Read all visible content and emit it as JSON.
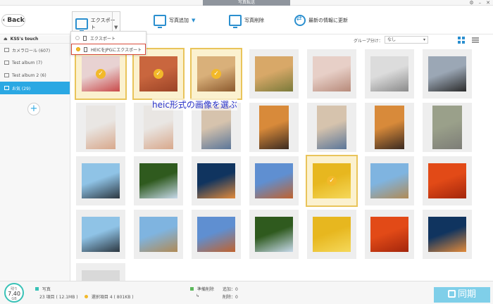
{
  "window": {
    "title": "写真転送"
  },
  "toolbar": {
    "back_label": "Back",
    "export_label": "エクスポート",
    "add_label": "写真追加",
    "delete_label": "写真削除",
    "refresh_label": "最新の情報に更新"
  },
  "export_menu": {
    "items": [
      {
        "label": "エクスポート"
      },
      {
        "label": "HEICをJPGにエクスポート"
      }
    ]
  },
  "subbar": {
    "group_label": "グループ分け：",
    "group_value": "なし"
  },
  "sidebar": {
    "device": "KSS's touch",
    "items": [
      {
        "label": "カメラロール (607)"
      },
      {
        "label": "Test album (7)"
      },
      {
        "label": "Test album 2 (6)"
      },
      {
        "label": "お気 (29)"
      }
    ]
  },
  "gallery": {
    "annotation": "heic形式の画像を選ぶ",
    "photos": [
      {
        "name": "kitten-sleeping",
        "selected": true,
        "colors": [
          "#e8d2d2",
          "#c94a4a"
        ]
      },
      {
        "name": "kitten-brick",
        "selected": true,
        "colors": [
          "#c9663e",
          "#9b4326"
        ]
      },
      {
        "name": "kittens-three",
        "selected": true,
        "colors": [
          "#d9b07a",
          "#8c5a2e"
        ]
      },
      {
        "name": "kittens-grass",
        "selected": false,
        "colors": [
          "#d8a868",
          "#7a7a3a"
        ]
      },
      {
        "name": "kitten-bed",
        "selected": false,
        "colors": [
          "#e7cfc7",
          "#b78a7a"
        ]
      },
      {
        "name": "kitten-grey",
        "selected": false,
        "colors": [
          "#dcdcdc",
          "#8a8a8a"
        ]
      },
      {
        "name": "vr-headset",
        "selected": false,
        "colors": [
          "#9ba7b5",
          "#2b2b2b"
        ]
      },
      {
        "name": "baby-1",
        "selected": false,
        "colors": [
          "#e9e6e3",
          "#d8a88c"
        ]
      },
      {
        "name": "baby-2",
        "selected": false,
        "colors": [
          "#e9e6e3",
          "#d8a88c"
        ]
      },
      {
        "name": "woman-denim-1",
        "selected": false,
        "colors": [
          "#d6c3ad",
          "#5b7699"
        ]
      },
      {
        "name": "woman-orange-1",
        "selected": false,
        "colors": [
          "#d88a3a",
          "#3b2a20"
        ]
      },
      {
        "name": "woman-denim-2",
        "selected": false,
        "colors": [
          "#d6c3ad",
          "#5b7699"
        ]
      },
      {
        "name": "woman-orange-2",
        "selected": false,
        "colors": [
          "#d88a3a",
          "#3b2a20"
        ]
      },
      {
        "name": "koala",
        "selected": false,
        "colors": [
          "#9aa08a",
          "#7d7d77"
        ]
      },
      {
        "name": "penguins-1",
        "selected": false,
        "colors": [
          "#8fc3e6",
          "#2c3740"
        ]
      },
      {
        "name": "hydrangea-1",
        "selected": false,
        "colors": [
          "#2f5a1e",
          "#c7d9ea"
        ]
      },
      {
        "name": "jellyfish-1",
        "selected": false,
        "colors": [
          "#10345f",
          "#e28a3a"
        ]
      },
      {
        "name": "desert-1",
        "selected": false,
        "colors": [
          "#5f8fd1",
          "#c0622e"
        ]
      },
      {
        "name": "tulips-1",
        "selected": true,
        "colors": [
          "#e7b71f",
          "#f5d85a"
        ]
      },
      {
        "name": "lighthouse-1",
        "selected": false,
        "colors": [
          "#7fb4e0",
          "#b08a55"
        ]
      },
      {
        "name": "chrysanthemum-1",
        "selected": false,
        "colors": [
          "#e24a17",
          "#a3260c"
        ]
      },
      {
        "name": "penguins-2",
        "selected": false,
        "colors": [
          "#8fc3e6",
          "#2c3740"
        ]
      },
      {
        "name": "lighthouse-2",
        "selected": false,
        "colors": [
          "#7fb4e0",
          "#b08a55"
        ]
      },
      {
        "name": "desert-2",
        "selected": false,
        "colors": [
          "#5f8fd1",
          "#c0622e"
        ]
      },
      {
        "name": "hydrangea-2",
        "selected": false,
        "colors": [
          "#2f5a1e",
          "#c7d9ea"
        ]
      },
      {
        "name": "tulips-2",
        "selected": false,
        "colors": [
          "#e7b71f",
          "#f5d85a"
        ]
      },
      {
        "name": "chrysanthemum-2",
        "selected": false,
        "colors": [
          "#e24a17",
          "#a3260c"
        ]
      },
      {
        "name": "jellyfish-2",
        "selected": false,
        "colors": [
          "#10345f",
          "#e28a3a"
        ]
      },
      {
        "name": "photo-partial",
        "selected": false,
        "colors": [
          "#d9d9d9",
          "#bdbdbd"
        ]
      }
    ]
  },
  "status": {
    "gauge_label": "残り",
    "gauge_value": "7.40",
    "gauge_unit": "GB",
    "photos_label": "写真",
    "items_text": "23 項目 ( 12.1MB )",
    "selected_text": "選択項目 4 ( 801KB )",
    "pending_label": "準備削除",
    "add_text": "追加：0",
    "del_text": "削除：0",
    "sync_label": "同期",
    "accent": "#39c2b7",
    "warn": "#f2b92a",
    "pending_color": "#5cb85c"
  }
}
